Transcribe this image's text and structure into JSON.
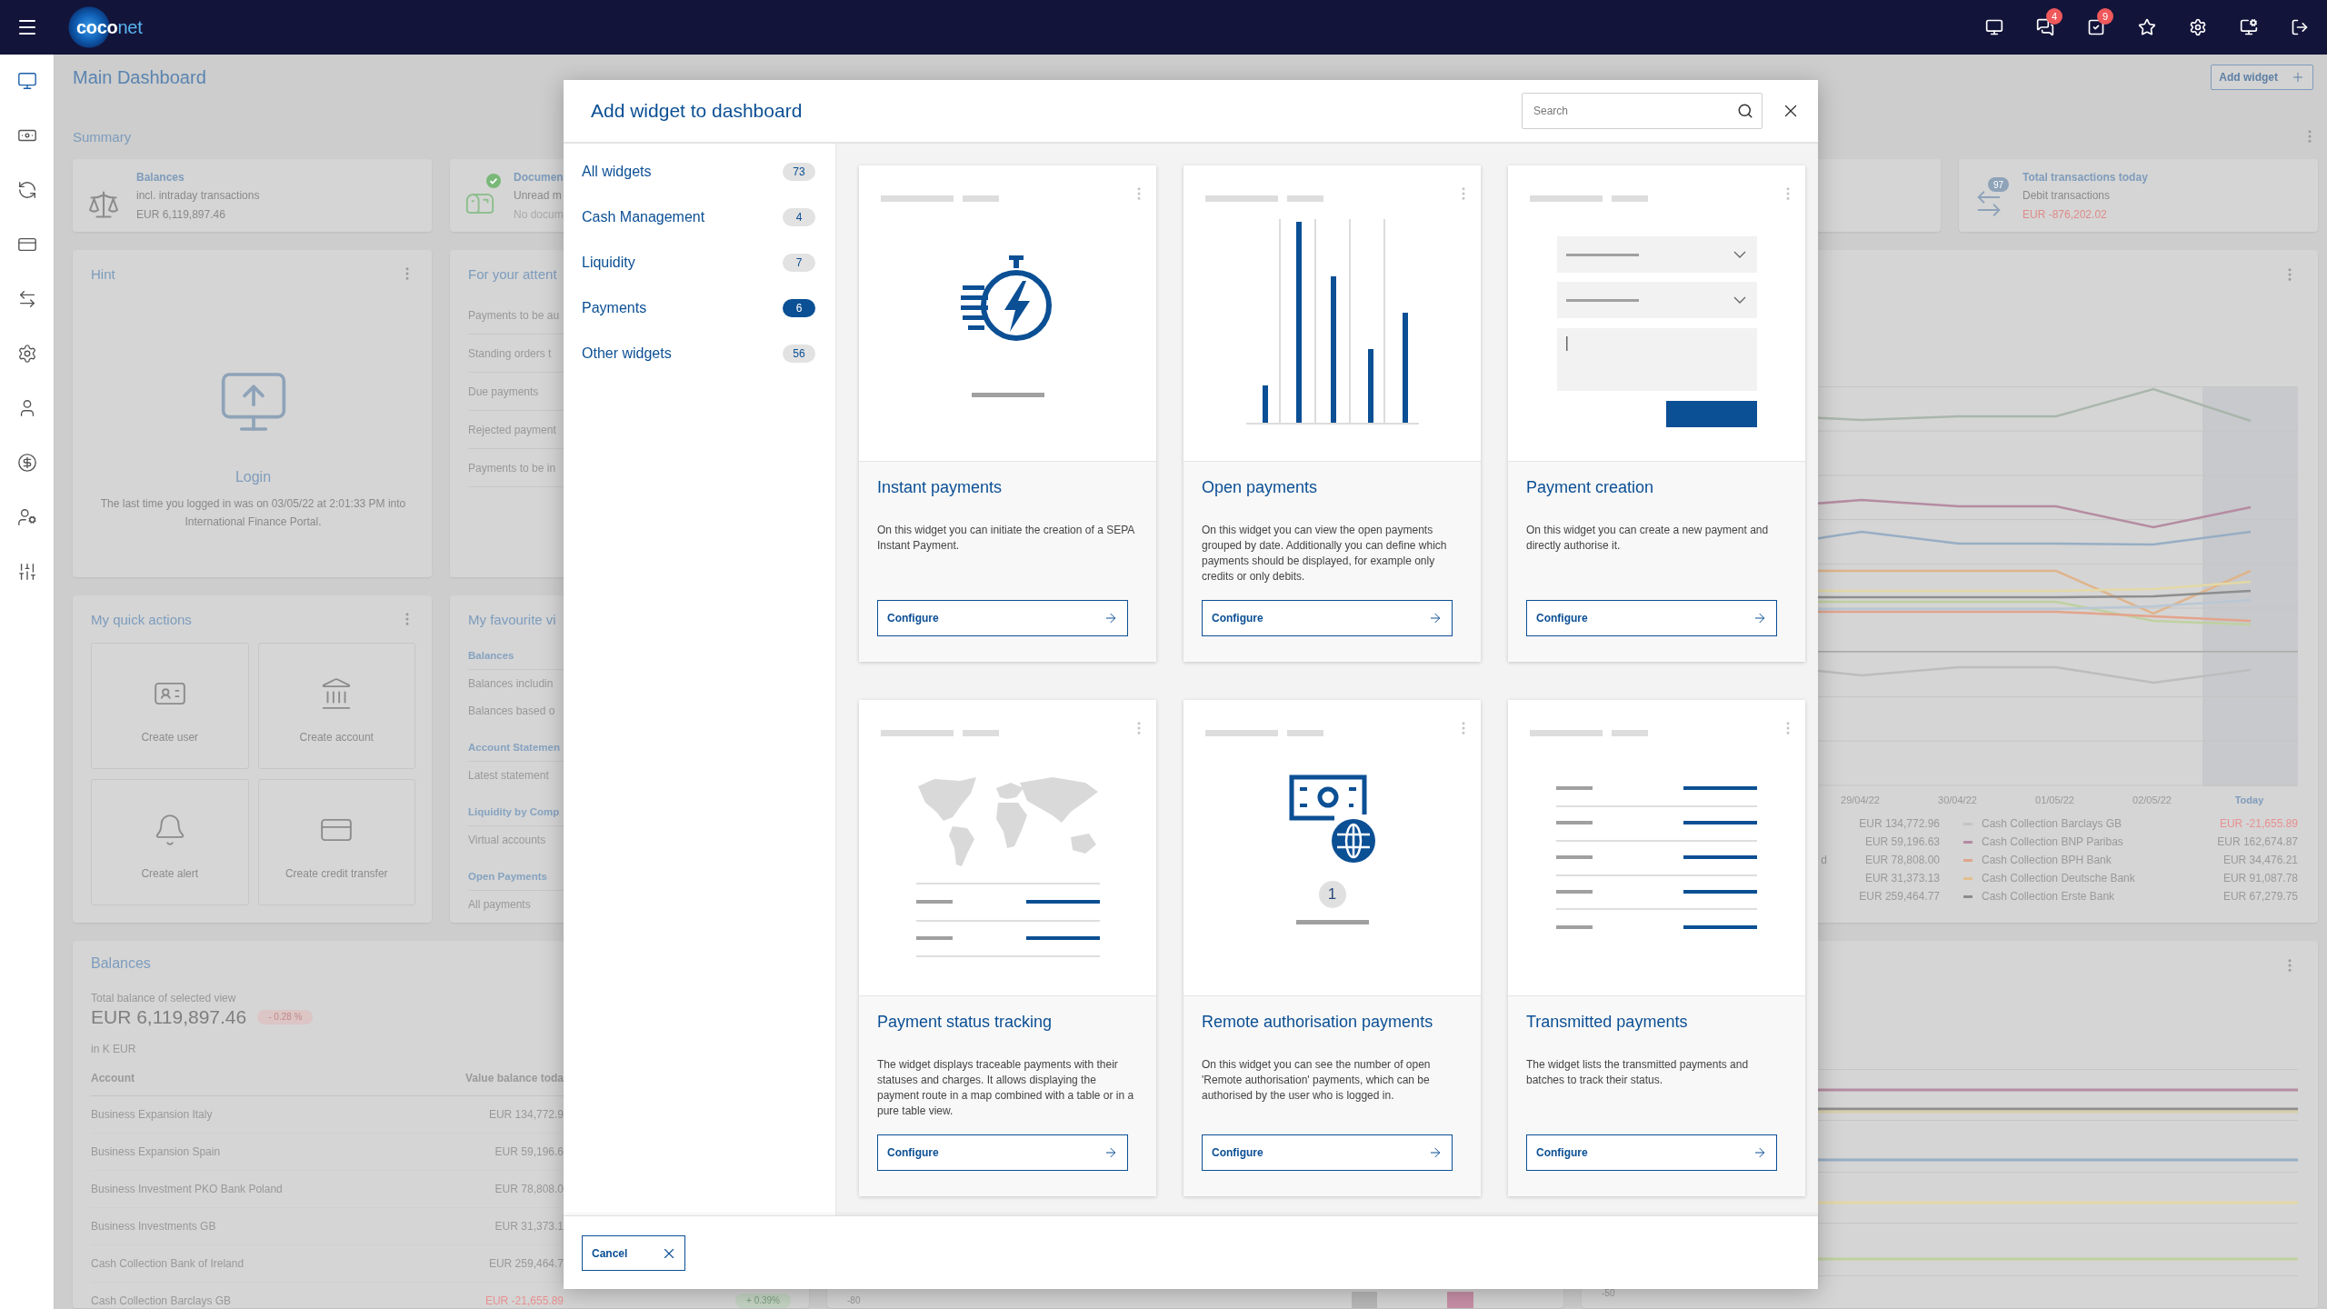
{
  "topbar": {
    "logo": [
      {
        "text": "coco",
        "accent": false
      },
      {
        "text": "net",
        "accent": true
      }
    ],
    "actions": [
      {
        "kind": "dashboard"
      },
      {
        "kind": "messages",
        "badge": "4"
      },
      {
        "kind": "tasks",
        "badge": "9"
      },
      {
        "kind": "favorites"
      },
      {
        "kind": "settings"
      },
      {
        "kind": "sync"
      },
      {
        "kind": "logout"
      }
    ]
  },
  "sidebar": [
    {
      "kind": "dashboard",
      "selected": true
    },
    {
      "kind": "money",
      "selected": false
    },
    {
      "kind": "exchange",
      "selected": false
    },
    {
      "kind": "cards",
      "selected": false
    },
    {
      "kind": "transfer",
      "selected": false
    },
    {
      "kind": "settings",
      "selected": false
    },
    {
      "kind": "user",
      "selected": false
    },
    {
      "kind": "dollar",
      "selected": false
    },
    {
      "kind": "admin",
      "selected": false
    },
    {
      "kind": "controls",
      "selected": false
    }
  ],
  "dashboard": {
    "title": "Main Dashboard",
    "add_widget": "Add widget",
    "summary_title": "Summary",
    "summary": [
      {
        "kind": "balances",
        "label": "Balances",
        "lines": [
          {
            "text": "incl. intraday transactions",
            "muted": false,
            "negative": false
          },
          {
            "text": "EUR 6,119,897.46",
            "muted": false,
            "negative": false
          }
        ]
      },
      {
        "kind": "documents",
        "verified": true,
        "label": "Documen",
        "lines": [
          {
            "text": "Unread m",
            "muted": false,
            "negative": false
          },
          {
            "text": "No docum",
            "muted": true,
            "negative": false
          }
        ]
      },
      {
        "kind": "blank"
      },
      {
        "kind": "transactions",
        "count": "97",
        "label": "Total transactions today",
        "lines": [
          {
            "text": "Debit transactions",
            "muted": false,
            "negative": false
          },
          {
            "text": "EUR -876,202.02",
            "muted": false,
            "negative": true
          }
        ]
      }
    ],
    "hint": {
      "title": "Hint",
      "heading": "Login",
      "message": "The last time you logged in was on 03/05/22 at 2:01:33 PM into International Finance Portal."
    },
    "attention": {
      "title": "For your attent",
      "items": [
        "Payments to be au",
        "Standing orders t",
        "Due payments",
        "Rejected payment",
        "Payments to be in"
      ]
    },
    "quick_actions": {
      "title": "My quick actions",
      "tiles": [
        {
          "kind": "user",
          "label": "Create user"
        },
        {
          "kind": "account",
          "label": "Create account"
        },
        {
          "kind": "alert",
          "label": "Create alert"
        },
        {
          "kind": "transfer",
          "label": "Create credit transfer"
        }
      ]
    },
    "favourites": {
      "title": "My favourite vi",
      "groups": [
        {
          "heading": "Balances",
          "items": [
            "Balances includin",
            "Balances based o"
          ]
        },
        {
          "heading": "Account Statemen",
          "items": [
            "Latest statement"
          ]
        },
        {
          "heading": "Liquidity by Comp",
          "items": [
            "Virtual accounts"
          ]
        },
        {
          "heading": "Open Payments",
          "items": [
            "All payments"
          ]
        }
      ]
    },
    "chart": {
      "x_labels": [
        {
          "text": "29/04/22",
          "current": false
        },
        {
          "text": "30/04/22",
          "current": false
        },
        {
          "text": "01/05/22",
          "current": false
        },
        {
          "text": "02/05/22",
          "current": false
        },
        {
          "text": "Today",
          "current": true
        }
      ],
      "legend": [
        {
          "left_value": "EUR 134,772.96",
          "name": "Cash Collection Barclays GB",
          "value": "EUR -21,655.89",
          "color": "#c4c4c4",
          "negative": true
        },
        {
          "left_value": "EUR 59,196.63",
          "name": "Cash Collection BNP Paribas",
          "value": "EUR 162,674.87",
          "color": "#b58ca2",
          "negative": false
        },
        {
          "left_name": "d",
          "left_value": "EUR 78,808.00",
          "name": "Cash Collection BPH Bank",
          "value": "EUR 34,476.21",
          "color": "#e0a58c",
          "negative": false
        },
        {
          "left_value": "EUR 31,373.13",
          "name": "Cash Collection Deutsche Bank",
          "value": "EUR 91,087.78",
          "color": "#e2c08e",
          "negative": false
        },
        {
          "left_value": "EUR 259,464.77",
          "name": "Cash Collection Erste Bank",
          "value": "EUR 67,279.75",
          "color": "#8c8c8c",
          "negative": false
        }
      ]
    },
    "balances": {
      "title": "Balances",
      "subtitle": "Total balance of selected view",
      "total": "EUR 6,119,897.46",
      "change": "- 0.28 %",
      "rising": false,
      "unit": "in K EUR",
      "columns": [
        "Account",
        "Value balance toda"
      ],
      "rows": [
        {
          "account": "Business Expansion Italy",
          "value": "EUR 134,772.9",
          "negative": false
        },
        {
          "account": "Business Expansion Spain",
          "value": "EUR 59,196.6",
          "negative": false
        },
        {
          "account": "Business Investment PKO Bank Poland",
          "value": "EUR 78,808.0",
          "negative": false
        },
        {
          "account": "Business Investments GB",
          "value": "EUR 31,373.1",
          "negative": false
        },
        {
          "account": "Cash Collection Bank of Ireland",
          "value": "EUR 259,464.7",
          "negative": false
        },
        {
          "account": "Cash Collection Barclays GB",
          "value": "EUR -21,655.89",
          "negative": true,
          "change": "+ 0.39%",
          "rising": true
        }
      ]
    },
    "bar_panel": {
      "axis_label": "-80"
    },
    "line_panel": {
      "axis_label": "-50"
    }
  },
  "modal": {
    "title": "Add widget to dashboard",
    "search_placeholder": "Search",
    "nav": [
      {
        "label": "All widgets",
        "count": "73",
        "selected": false
      },
      {
        "label": "Cash Management",
        "count": "4",
        "selected": false
      },
      {
        "label": "Liquidity",
        "count": "7",
        "selected": false
      },
      {
        "label": "Payments",
        "count": "6",
        "selected": true
      },
      {
        "label": "Other widgets",
        "count": "56",
        "selected": false
      }
    ],
    "widgets": [
      {
        "kind": "instant",
        "title": "Instant payments",
        "description": "On this widget you can initiate the creation of a SEPA Instant Payment.",
        "action": "Configure"
      },
      {
        "kind": "bars",
        "title": "Open payments",
        "description": "On this widget you can view the open payments grouped by date. Additionally you can define which payments should be displayed, for example only credits or only debits.",
        "action": "Configure"
      },
      {
        "kind": "form",
        "title": "Payment creation",
        "description": "On this widget you can create a new payment and directly authorise it.",
        "action": "Configure"
      },
      {
        "kind": "map",
        "title": "Payment status tracking",
        "description": "The widget displays traceable payments with their statuses and charges. It allows displaying the payment route in a map combined with a table or in a pure table view.",
        "action": "Configure"
      },
      {
        "kind": "remote",
        "preview_count": "1",
        "title": "Remote authorisation payments",
        "description": "On this widget you can see the number of open 'Remote authorisation' payments, which can be authorised by the user who is logged in.",
        "action": "Configure"
      },
      {
        "kind": "list",
        "title": "Transmitted payments",
        "description": "The widget lists the transmitted payments and batches to track their status.",
        "action": "Configure"
      }
    ],
    "cancel": "Cancel"
  }
}
